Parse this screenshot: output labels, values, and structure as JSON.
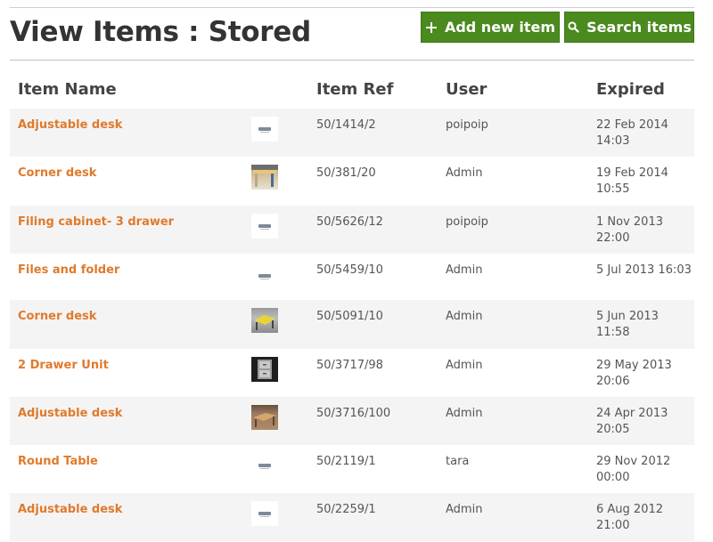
{
  "page": {
    "title": "View Items : Stored"
  },
  "toolbar": {
    "add_label": "Add new item",
    "search_label": "Search items",
    "accent_color": "#4a8a1e"
  },
  "table": {
    "columns": [
      "Item Name",
      "Item Ref",
      "User",
      "Expired"
    ],
    "rows": [
      {
        "name": "Adjustable desk",
        "thumb": "logo",
        "ref": "50/1414/2",
        "user": "poipoip",
        "expired": "22 Feb 2014 14:03"
      },
      {
        "name": "Corner desk",
        "thumb": "corner-desk-photo",
        "ref": "50/381/20",
        "user": "Admin",
        "expired": "19 Feb 2014 10:55"
      },
      {
        "name": "Filing cabinet- 3 drawer",
        "thumb": "logo",
        "ref": "50/5626/12",
        "user": "poipoip",
        "expired": "1 Nov 2013 22:00"
      },
      {
        "name": "Files and folder",
        "thumb": "logo",
        "ref": "50/5459/10",
        "user": "Admin",
        "expired": "5 Jul 2013 16:03"
      },
      {
        "name": "Corner desk",
        "thumb": "yellow-desk-photo",
        "ref": "50/5091/10",
        "user": "Admin",
        "expired": "5 Jun 2013 11:58"
      },
      {
        "name": "2 Drawer Unit",
        "thumb": "drawer-unit-photo",
        "ref": "50/3717/98",
        "user": "Admin",
        "expired": "29 May 2013 20:06"
      },
      {
        "name": "Adjustable desk",
        "thumb": "wood-desk-photo",
        "ref": "50/3716/100",
        "user": "Admin",
        "expired": "24 Apr 2013 20:05"
      },
      {
        "name": "Round Table",
        "thumb": "logo",
        "ref": "50/2119/1",
        "user": "tara",
        "expired": "29 Nov 2012 00:00"
      },
      {
        "name": "Adjustable desk",
        "thumb": "logo",
        "ref": "50/2259/1",
        "user": "Admin",
        "expired": "6 Aug 2012 21:00"
      }
    ]
  }
}
